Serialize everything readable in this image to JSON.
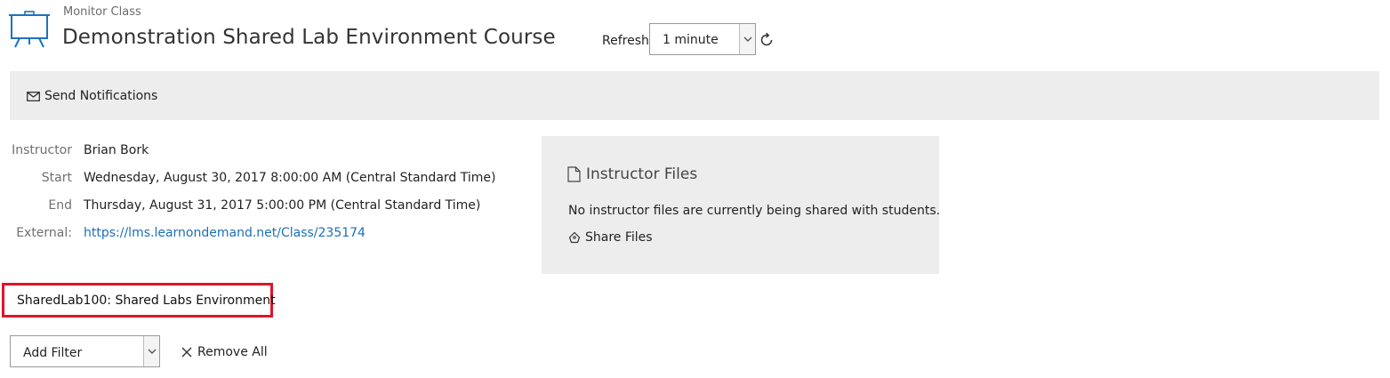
{
  "header": {
    "breadcrumb": "Monitor Class",
    "title": "Demonstration Shared Lab Environment Course",
    "refresh_label": "Refresh",
    "refresh_value": "1 minute"
  },
  "toolbar": {
    "send_notifications": "Send Notifications"
  },
  "details": {
    "instructor_label": "Instructor",
    "instructor_value": "Brian Bork",
    "start_label": "Start",
    "start_value": "Wednesday, August 30, 2017 8:00:00 AM (Central Standard Time)",
    "end_label": "End",
    "end_value": "Thursday, August 31, 2017 5:00:00 PM (Central Standard Time)",
    "external_label": "External:",
    "external_value": "https://lms.learnondemand.net/Class/235174"
  },
  "instructor_files": {
    "title": "Instructor Files",
    "message": "No instructor files are currently being shared with students.",
    "share_label": "Share Files"
  },
  "lab": {
    "label": "SharedLab100: Shared Labs Environment"
  },
  "filters": {
    "add_filter": "Add Filter",
    "remove_all": "Remove All"
  },
  "colors": {
    "accent": "#1c6fb8",
    "highlight": "#e0142b",
    "panel": "#ededed"
  },
  "icons": [
    "presentation-board-icon",
    "refresh-icon",
    "envelope-icon",
    "document-icon",
    "share-icon",
    "rocket-icon",
    "close-icon",
    "chevron-down-icon"
  ]
}
